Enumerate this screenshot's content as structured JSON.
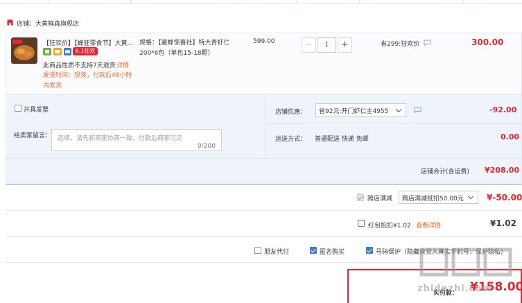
{
  "shop": {
    "name": "店铺：大黄鲜森旗舰店"
  },
  "item": {
    "title": "【狂欢价】【蜂狂零食节】大黄...",
    "promo_badge": "6.1狂欢",
    "no_return_note": "此商品性质不支持7天退货",
    "detail_link": "详情",
    "ship_time": "发货时间：现货，付款后48小时内发货",
    "spec": "规格：【蜜蜂惊喜社】特大青虾仁200*6包（单包15-18颗）",
    "unit_price": "599.00",
    "quantity": "1",
    "promo_text": "省299:狂欢价",
    "line_total": "300.00"
  },
  "options": {
    "invoice_label": "开具发票",
    "message_label": "给卖家留言：",
    "message_placeholder": "选填，请先和商家协商一致，付款后商家可见",
    "message_count": "0/200",
    "coupon_label": "店铺优惠：",
    "coupon_value": "省92元:开门虾仁主4955",
    "coupon_amount": "-92.00",
    "ship_label": "运送方式：",
    "ship_method": "普通配送 快递 免邮",
    "ship_amount": "0.00"
  },
  "subtotal": {
    "label": "店铺合计(含运费)",
    "amount": "¥208.00"
  },
  "cross_store": {
    "label": "跨店满减",
    "select_value": "跨店满减抵扣50.00元",
    "amount": "¥-50.00"
  },
  "red_packet": {
    "label": "红包抵扣¥1.02",
    "link": "查看详情",
    "amount": "¥1.02"
  },
  "footer_options": {
    "friend_pay": "朋友代付",
    "anonymous": "匿名购买",
    "number_protect": "号码保护（隐藏收货人真实手机号，保护隐私）"
  },
  "payment": {
    "label": "实付款：",
    "amount": "¥158.00"
  },
  "watermark": {
    "text": "zhidezhi.com"
  },
  "colors": {
    "accent": "#e8242f",
    "link": "#f26b2c",
    "check": "#3a7cd8",
    "panel": "#eff4fb"
  }
}
